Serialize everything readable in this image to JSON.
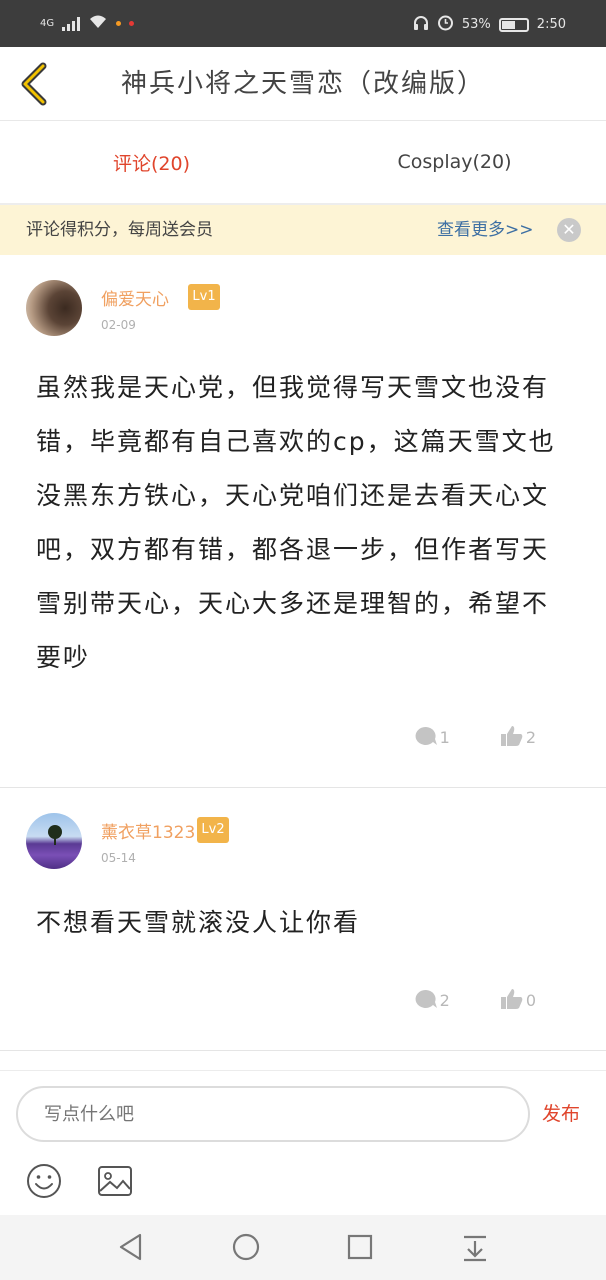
{
  "status_bar": {
    "network": "4G",
    "battery": "53%",
    "battery_level": 0.53,
    "time": "2:50"
  },
  "header": {
    "title": "神兵小将之天雪恋（改编版）"
  },
  "tabs": [
    {
      "label": "评论(20)",
      "active": true
    },
    {
      "label": "Cosplay(20)",
      "active": false
    }
  ],
  "notice": {
    "text": "评论得积分，每周送会员",
    "link": "查看更多>>"
  },
  "comments": [
    {
      "username": "偏爱天心",
      "level": "Lv1",
      "date": "02-09",
      "text": "虽然我是天心党，但我觉得写天雪文也没有错，毕竟都有自己喜欢的cp，这篇天雪文也没黑东方铁心，天心党咱们还是去看天心文吧，双方都有错，都各退一步，但作者写天雪别带天心，天心大多还是理智的，希望不要吵",
      "reply_count": "1",
      "like_count": "2"
    },
    {
      "username": "薰衣草1323",
      "level": "Lv2",
      "date": "05-14",
      "text": "不想看天雪就滚没人让你看",
      "reply_count": "2",
      "like_count": "0"
    }
  ],
  "input_bar": {
    "placeholder": "写点什么吧",
    "publish_label": "发布"
  },
  "colors": {
    "accent": "#e0452c",
    "username": "#f0a060",
    "level_badge": "#f2b44a",
    "notice_bg": "#fdf4d5",
    "link": "#3d6fa3"
  }
}
